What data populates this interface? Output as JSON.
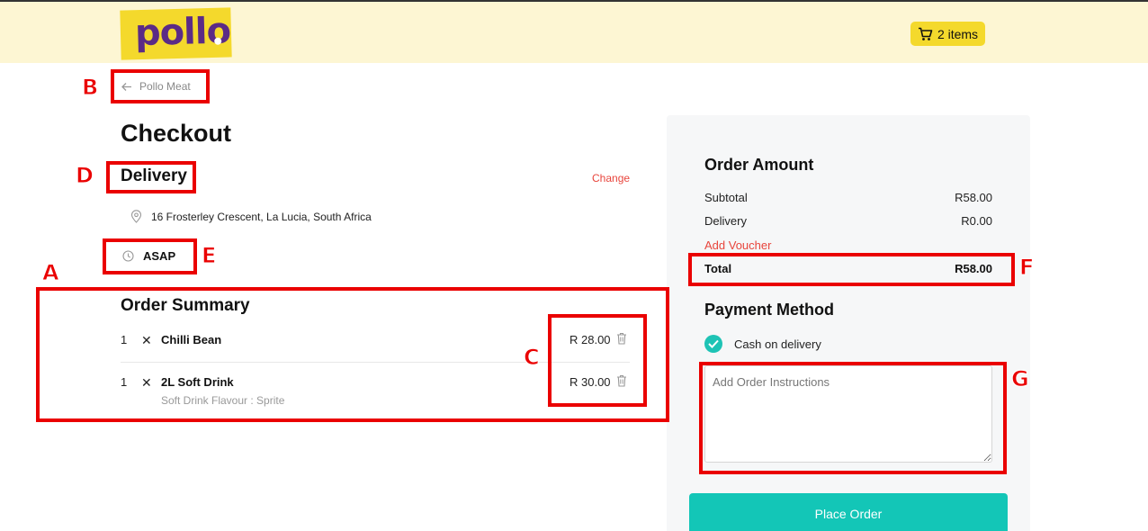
{
  "header": {
    "logo_text": "pollo",
    "cart_label": "2 items"
  },
  "nav": {
    "back_label": "Pollo Meat"
  },
  "checkout": {
    "title": "Checkout",
    "delivery_heading": "Delivery",
    "change_label": "Change",
    "address": "16 Frosterley Crescent, La Lucia, South Africa",
    "time": "ASAP"
  },
  "summary": {
    "heading": "Order Summary",
    "items": [
      {
        "qty": "1",
        "name": "Chilli Bean",
        "option": "",
        "price": "R 28.00"
      },
      {
        "qty": "1",
        "name": "2L Soft Drink",
        "option": "Soft Drink Flavour : Sprite",
        "price": "R 30.00"
      }
    ]
  },
  "order_amount": {
    "heading": "Order Amount",
    "subtotal_label": "Subtotal",
    "subtotal_value": "R58.00",
    "delivery_label": "Delivery",
    "delivery_value": "R0.00",
    "voucher_label": "Add Voucher",
    "total_label": "Total",
    "total_value": "R58.00"
  },
  "payment": {
    "heading": "Payment Method",
    "method": "Cash on delivery",
    "instructions_placeholder": "Add Order Instructions",
    "place_order_label": "Place Order"
  },
  "annotations": {
    "a": "A",
    "b": "B",
    "c": "C",
    "d": "D",
    "e": "E",
    "f": "F",
    "g": "G"
  },
  "colors": {
    "brand_yellow": "#f4d92c",
    "brand_purple": "#5b2b86",
    "accent_teal": "#13c6b7",
    "link_red": "#e8453c",
    "annotation_red": "#ea0000"
  }
}
